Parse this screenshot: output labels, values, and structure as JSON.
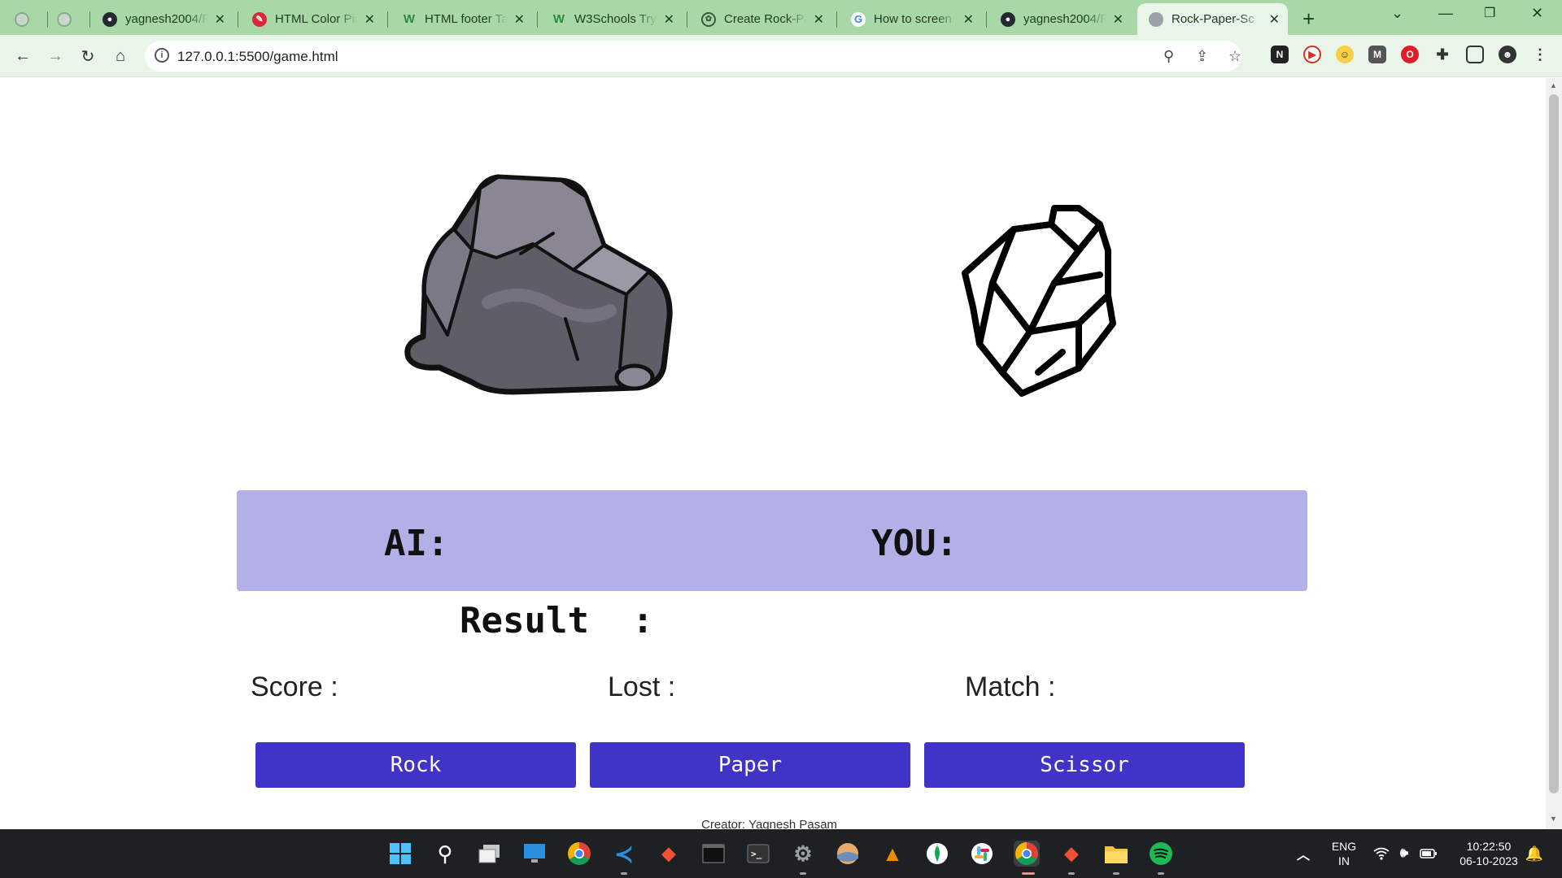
{
  "browser": {
    "tabs": [
      {
        "title": "yagnesh2004/R",
        "icon": "github-icon"
      },
      {
        "title": "HTML Color Pic",
        "icon": "color-picker-icon"
      },
      {
        "title": "HTML footer Ta",
        "icon": "w3schools-icon"
      },
      {
        "title": "W3Schools Tryi",
        "icon": "w3schools-icon"
      },
      {
        "title": "Create Rock-Pa",
        "icon": "chatgpt-icon"
      },
      {
        "title": "How to screen",
        "icon": "google-icon"
      },
      {
        "title": "yagnesh2004/R",
        "icon": "github-icon"
      },
      {
        "title": "Rock-Paper-Sc",
        "icon": "globe-icon"
      }
    ],
    "url_host": "127.0.0.1",
    "url_path": ":5500/game.html"
  },
  "game": {
    "ai_label": "AI:",
    "you_label": "YOU:",
    "result_label": "Result  :",
    "score_label": "Score :",
    "lost_label": "Lost :",
    "match_label": "Match :",
    "buttons": {
      "rock": "Rock",
      "paper": "Paper",
      "scissor": "Scissor"
    },
    "footer": "Creator: Yagnesh Pasam"
  },
  "taskbar": {
    "language": "ENG",
    "region": "IN",
    "time": "10:22:50",
    "date": "06-10-2023"
  },
  "colors": {
    "panel_bg": "#b3b0e8",
    "button_bg": "#4034c8",
    "tab_strip": "#a8d8a8",
    "toolbar": "#e8f5e8"
  }
}
